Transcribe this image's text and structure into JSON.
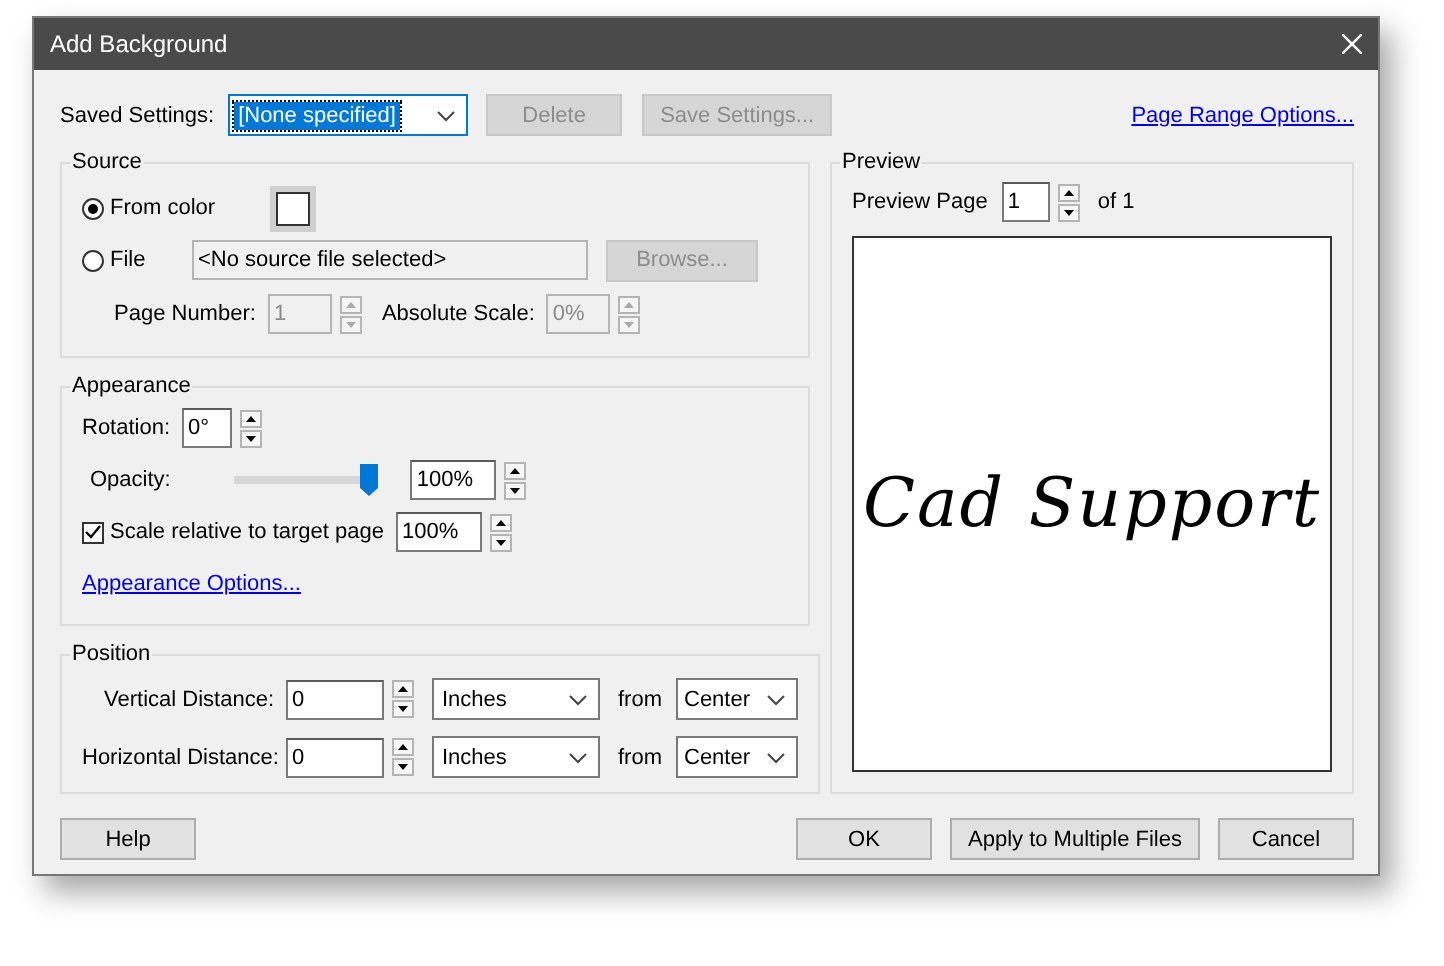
{
  "window": {
    "title": "Add Background"
  },
  "saved_settings": {
    "label": "Saved Settings:",
    "value": "[None specified]"
  },
  "top_buttons": [
    {
      "label": "Delete",
      "disabled": true
    },
    {
      "label": "Save Settings...",
      "disabled": true
    }
  ],
  "page_range_link": "Page Range Options...",
  "source": {
    "title": "Source",
    "options": [
      {
        "kind": "color",
        "label": "From color",
        "selected": true
      },
      {
        "kind": "file",
        "label": "File",
        "selected": false,
        "value": "<No source file selected>"
      }
    ],
    "browse_button": {
      "label": "Browse...",
      "disabled": true
    },
    "page_number": {
      "label": "Page Number:",
      "value": "1",
      "disabled": true
    },
    "absolute_scale": {
      "label": "Absolute Scale:",
      "value": "0%",
      "disabled": true
    }
  },
  "appearance": {
    "title": "Appearance",
    "rotation": {
      "label": "Rotation:",
      "value": "0°"
    },
    "opacity": {
      "label": "Opacity:",
      "level": 1,
      "value": "100%"
    },
    "scale": {
      "label": "Scale relative to target page",
      "checked": true,
      "value": "100%"
    },
    "link": "Appearance Options..."
  },
  "position": {
    "title": "Position",
    "rows": [
      {
        "label": "Vertical Distance:",
        "value": "0",
        "unit": "Inches",
        "from_label": "from",
        "anchor": "Center"
      },
      {
        "label": "Horizontal Distance:",
        "value": "0",
        "unit": "Inches",
        "from_label": "from",
        "anchor": "Center"
      }
    ]
  },
  "preview": {
    "title": "Preview",
    "page_label": "Preview Page",
    "page_value": "1",
    "of_text": "of 1",
    "content": "Cad Support"
  },
  "bottom_buttons": [
    {
      "label": "Help"
    },
    {
      "label": "OK"
    },
    {
      "label": "Apply to Multiple Files"
    },
    {
      "label": "Cancel"
    }
  ]
}
